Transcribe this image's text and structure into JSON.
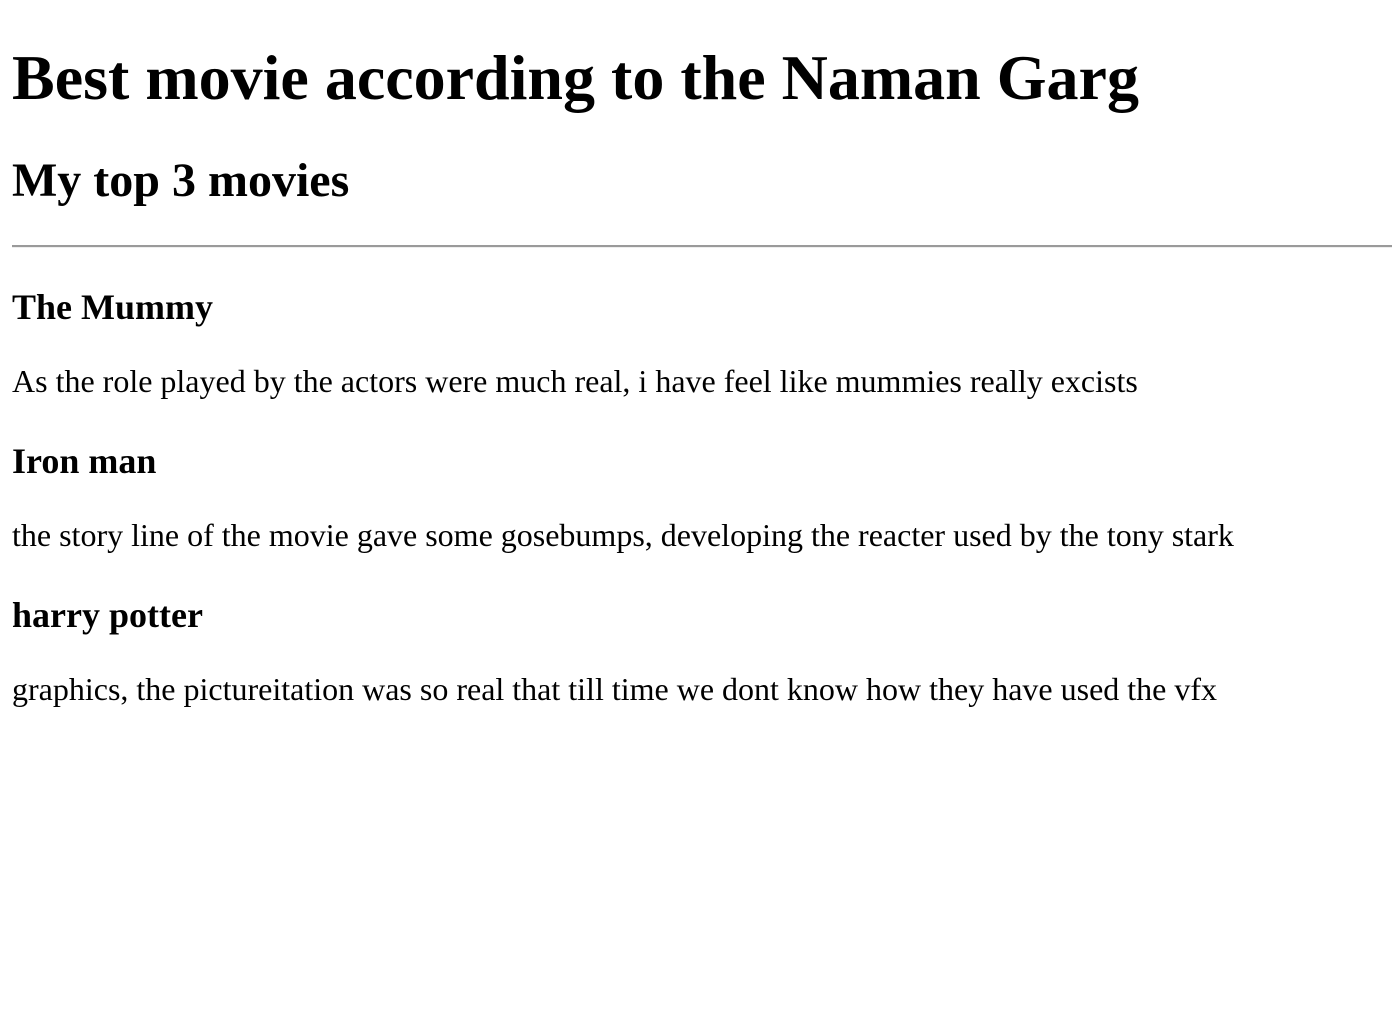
{
  "page": {
    "title": "Best movie according to the Naman Garg",
    "subtitle": "My top 3 movies"
  },
  "movies": [
    {
      "title": "The Mummy",
      "description": "As the role played by the actors were much real, i have feel like mummies really excists"
    },
    {
      "title": "Iron man",
      "description": "the story line of the movie gave some gosebumps, developing the reacter used by the tony stark"
    },
    {
      "title": "harry potter",
      "description": "graphics, the pictureitation was so real that till time we dont know how they have used the vfx"
    }
  ]
}
